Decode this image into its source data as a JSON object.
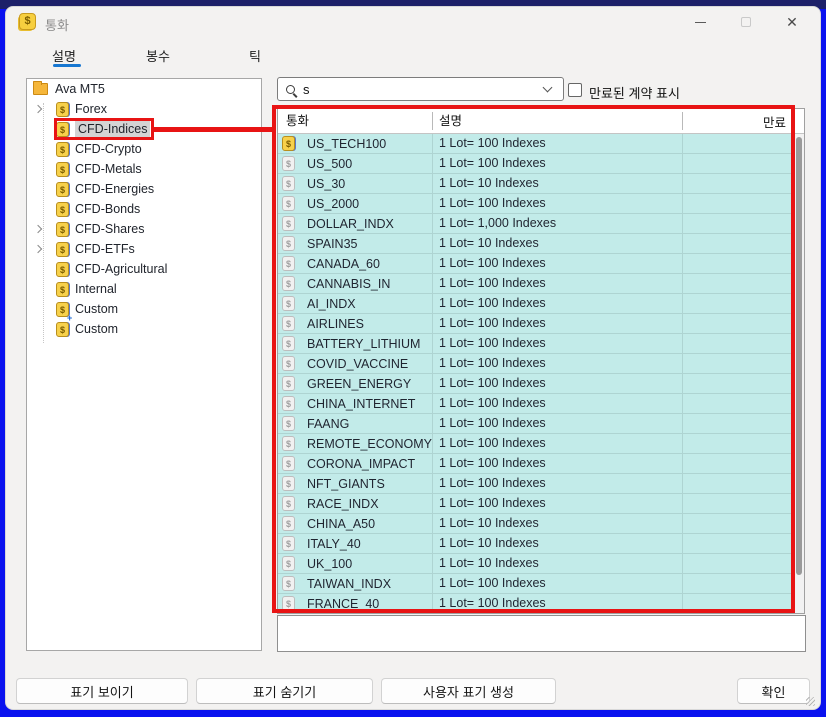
{
  "window": {
    "title": "통화"
  },
  "tabs": [
    {
      "label": "설명",
      "active": true
    },
    {
      "label": "봉수",
      "active": false
    },
    {
      "label": "틱",
      "active": false
    }
  ],
  "tree": {
    "root_label": "Ava MT5",
    "items": [
      {
        "label": "Forex",
        "expandable": true,
        "selected": false,
        "plus": false
      },
      {
        "label": "CFD-Indices",
        "expandable": false,
        "selected": true,
        "plus": false
      },
      {
        "label": "CFD-Crypto",
        "expandable": false,
        "selected": false,
        "plus": false
      },
      {
        "label": "CFD-Metals",
        "expandable": false,
        "selected": false,
        "plus": false
      },
      {
        "label": "CFD-Energies",
        "expandable": false,
        "selected": false,
        "plus": false
      },
      {
        "label": "CFD-Bonds",
        "expandable": false,
        "selected": false,
        "plus": false
      },
      {
        "label": "CFD-Shares",
        "expandable": true,
        "selected": false,
        "plus": false
      },
      {
        "label": "CFD-ETFs",
        "expandable": true,
        "selected": false,
        "plus": false
      },
      {
        "label": "CFD-Agricultural",
        "expandable": false,
        "selected": false,
        "plus": false
      },
      {
        "label": "Internal",
        "expandable": false,
        "selected": false,
        "plus": false
      },
      {
        "label": "Custom",
        "expandable": false,
        "selected": false,
        "plus": false
      },
      {
        "label": "Custom",
        "expandable": false,
        "selected": false,
        "plus": true
      }
    ]
  },
  "search": {
    "value": "s"
  },
  "expired_checkbox": {
    "label": "만료된 계약 표시",
    "checked": false
  },
  "table": {
    "columns": {
      "symbol": "통화",
      "description": "설명",
      "expiration": "만료"
    },
    "rows": [
      {
        "symbol": "US_TECH100",
        "description": "1 Lot= 100 Indexes",
        "icon": "gold"
      },
      {
        "symbol": "US_500",
        "description": "1 Lot= 100 Indexes",
        "icon": "gray"
      },
      {
        "symbol": "US_30",
        "description": "1 Lot= 10 Indexes",
        "icon": "gray"
      },
      {
        "symbol": "US_2000",
        "description": "1 Lot= 100 Indexes",
        "icon": "gray"
      },
      {
        "symbol": "DOLLAR_INDX",
        "description": "1 Lot= 1,000 Indexes",
        "icon": "gray"
      },
      {
        "symbol": "SPAIN35",
        "description": "1 Lot= 10 Indexes",
        "icon": "gray"
      },
      {
        "symbol": "CANADA_60",
        "description": "1 Lot= 100 Indexes",
        "icon": "gray"
      },
      {
        "symbol": "CANNABIS_IN",
        "description": "1 Lot= 100 Indexes",
        "icon": "gray"
      },
      {
        "symbol": "AI_INDX",
        "description": "1 Lot= 100 Indexes",
        "icon": "gray"
      },
      {
        "symbol": "AIRLINES",
        "description": "1 Lot= 100 Indexes",
        "icon": "gray"
      },
      {
        "symbol": "BATTERY_LITHIUM",
        "description": "1 Lot= 100 Indexes",
        "icon": "gray"
      },
      {
        "symbol": "COVID_VACCINE",
        "description": "1 Lot= 100 Indexes",
        "icon": "gray"
      },
      {
        "symbol": "GREEN_ENERGY",
        "description": "1 Lot= 100 Indexes",
        "icon": "gray"
      },
      {
        "symbol": "CHINA_INTERNET",
        "description": "1 Lot= 100 Indexes",
        "icon": "gray"
      },
      {
        "symbol": "FAANG",
        "description": "1 Lot= 100 Indexes",
        "icon": "gray"
      },
      {
        "symbol": "REMOTE_ECONOMY",
        "description": "1 Lot= 100 Indexes",
        "icon": "gray"
      },
      {
        "symbol": "CORONA_IMPACT",
        "description": "1 Lot= 100 Indexes",
        "icon": "gray"
      },
      {
        "symbol": "NFT_GIANTS",
        "description": "1 Lot= 100 Indexes",
        "icon": "gray"
      },
      {
        "symbol": "RACE_INDX",
        "description": "1 Lot= 100 Indexes",
        "icon": "gray"
      },
      {
        "symbol": "CHINA_A50",
        "description": "1 Lot= 10 Indexes",
        "icon": "gray"
      },
      {
        "symbol": "ITALY_40",
        "description": "1 Lot= 10 Indexes",
        "icon": "gray"
      },
      {
        "symbol": "UK_100",
        "description": "1 Lot= 10 Indexes",
        "icon": "gray"
      },
      {
        "symbol": "TAIWAN_INDX",
        "description": "1 Lot= 100 Indexes",
        "icon": "gray"
      },
      {
        "symbol": "FRANCE_40",
        "description": "1 Lot= 100 Indexes",
        "icon": "gray"
      }
    ]
  },
  "footer": {
    "show_symbol": "표기 보이기",
    "hide_symbol": "표기 숨기기",
    "create_custom_symbol": "사용자 표기 생성",
    "ok": "확인"
  },
  "colors": {
    "annotation_red": "#e81414",
    "row_cyan": "#c2ebe9",
    "tab_accent_blue": "#1777d1",
    "coin_gold": "#f7d14b",
    "frame_blue": "#0a12ef"
  }
}
